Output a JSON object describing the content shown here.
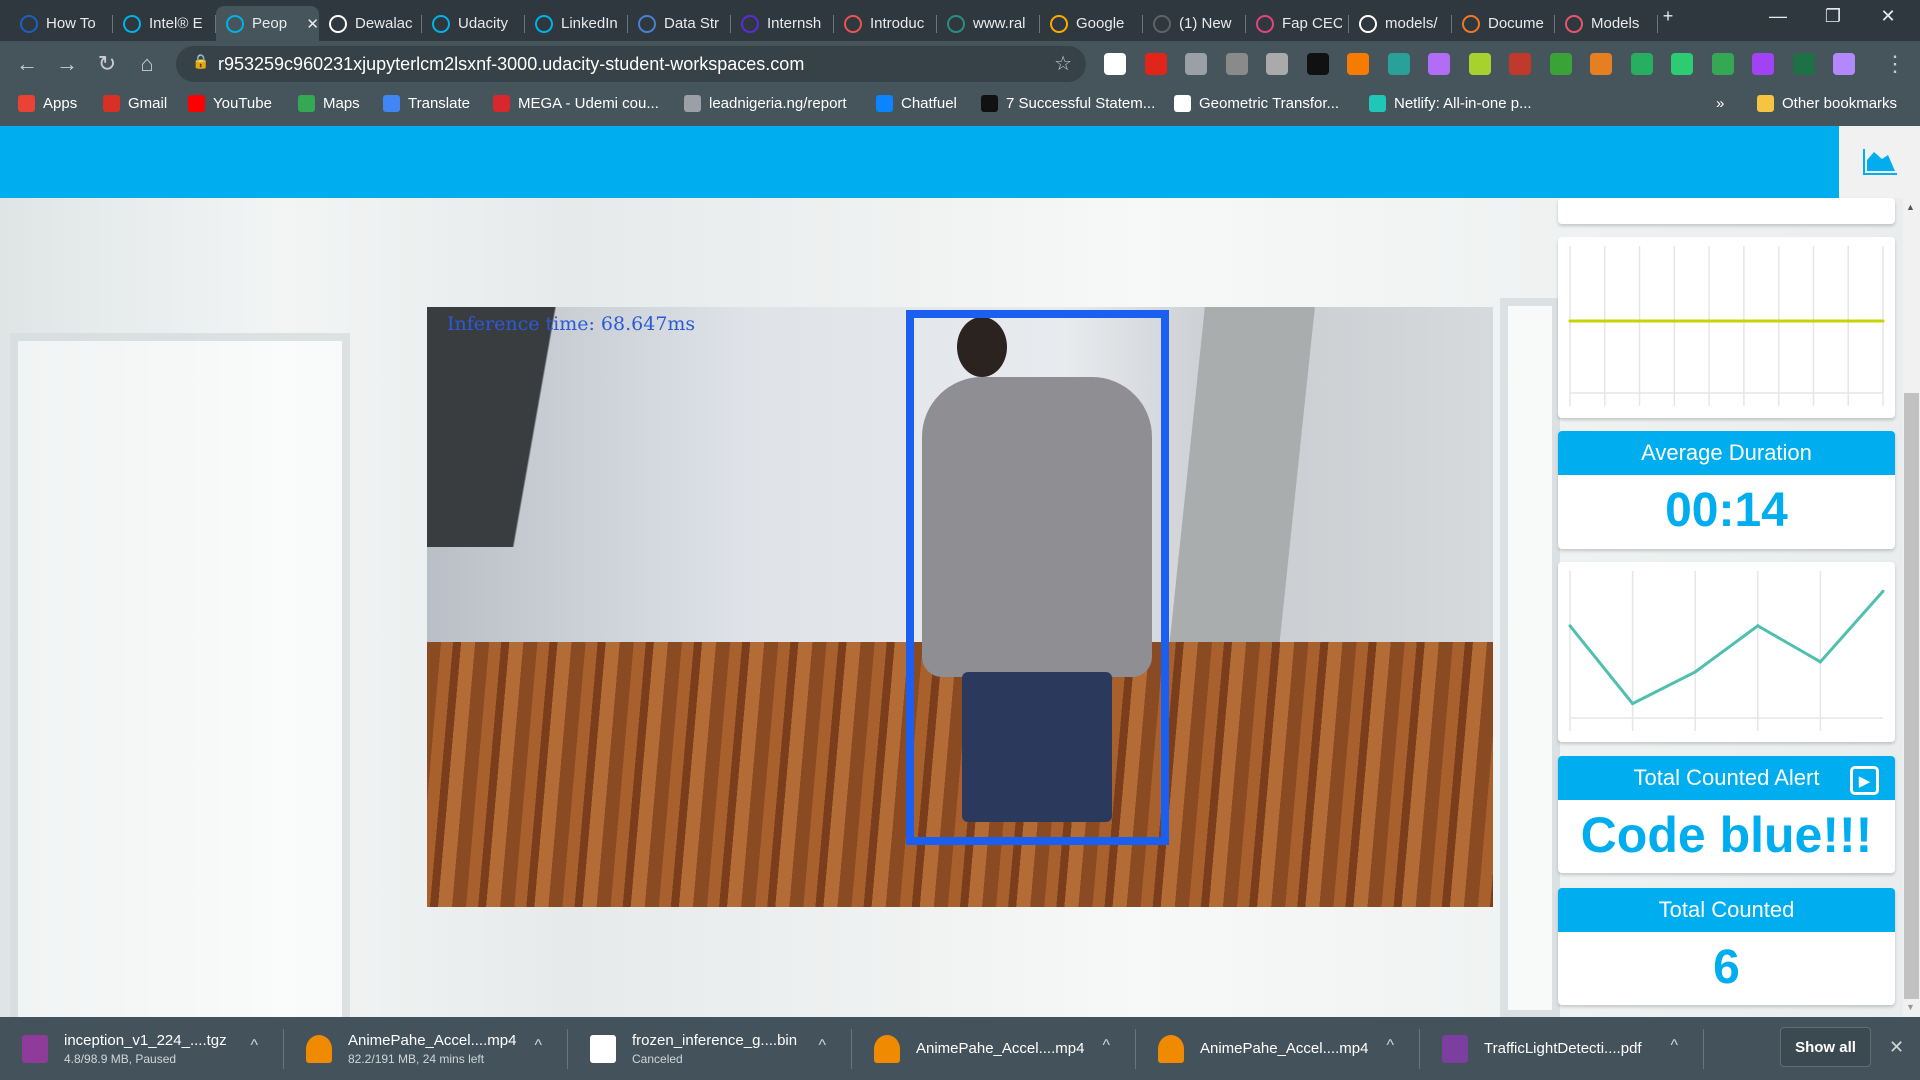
{
  "browser": {
    "tabs": [
      {
        "label": "How To",
        "icon": "edge-e-icon",
        "color": "#1e5fbf"
      },
      {
        "label": "Intel® E",
        "icon": "udacity-icon",
        "color": "#02b3e4"
      },
      {
        "label": "Peop",
        "icon": "udacity-icon",
        "color": "#02b3e4",
        "active": true
      },
      {
        "label": "Dewalac",
        "icon": "github-icon",
        "color": "#ffffff"
      },
      {
        "label": "Udacity",
        "icon": "udacity-icon",
        "color": "#02b3e4"
      },
      {
        "label": "LinkedIn",
        "icon": "udacity-icon",
        "color": "#02b3e4"
      },
      {
        "label": "Data Str",
        "icon": "infinity-icon",
        "color": "#4a7fd1"
      },
      {
        "label": "Internsh",
        "icon": "hash-icon",
        "color": "#5b2bd8"
      },
      {
        "label": "Introduc",
        "icon": "udemy-icon",
        "color": "#ec5252"
      },
      {
        "label": "www.ral",
        "icon": "t-icon",
        "color": "#2e8b7f"
      },
      {
        "label": "Google",
        "icon": "analytics-icon",
        "color": "#f9ab00"
      },
      {
        "label": "(1) New",
        "icon": "globe-icon",
        "color": "#5f6368"
      },
      {
        "label": "Fap CEC",
        "icon": "fap-icon",
        "color": "#e0457b"
      },
      {
        "label": "models/",
        "icon": "github-icon",
        "color": "#ffffff"
      },
      {
        "label": "Docume",
        "icon": "jupyter-icon",
        "color": "#f37726"
      },
      {
        "label": "Models",
        "icon": "tree-icon",
        "color": "#e8566c"
      }
    ],
    "new_tab": "+",
    "url": "r953259c960231xjupyterlcm2lsxnf-3000.udacity-student-workspaces.com",
    "bookmarks": [
      {
        "label": "Apps",
        "color": "#ea4335"
      },
      {
        "label": "Gmail",
        "color": "#d93025"
      },
      {
        "label": "YouTube",
        "color": "#ff0000"
      },
      {
        "label": "Maps",
        "color": "#34a853"
      },
      {
        "label": "Translate",
        "color": "#4285f4"
      },
      {
        "label": "MEGA - Udemi cou...",
        "color": "#d9272e"
      },
      {
        "label": "leadnigeria.ng/report",
        "color": "#9aa0a6"
      },
      {
        "label": "Chatfuel",
        "color": "#0a84ff"
      },
      {
        "label": "7 Successful Statem...",
        "color": "#111111"
      },
      {
        "label": "Geometric Transfor...",
        "color": "#ffffff"
      },
      {
        "label": "Netlify: All-in-one p...",
        "color": "#20c6b7"
      }
    ],
    "overflow": "»",
    "other_bookmarks": "Other bookmarks"
  },
  "app": {
    "accent": "#00aeef",
    "video": {
      "overlay_text": "Inference time: 68.647ms",
      "box_color": "#1a5ff0"
    },
    "cards": {
      "average_duration": {
        "title": "Average Duration",
        "value": "00:14"
      },
      "alert": {
        "title": "Total Counted Alert",
        "value": "Code blue!!!"
      },
      "total": {
        "title": "Total Counted",
        "value": "6"
      }
    }
  },
  "chart_data": [
    {
      "type": "line",
      "values": [
        50,
        50,
        50,
        50,
        50,
        50,
        50,
        50,
        50,
        50
      ],
      "ylim": [
        0,
        100
      ],
      "grid": true,
      "color": "#c8d400"
    },
    {
      "type": "line",
      "values": [
        64,
        10,
        32,
        64,
        39,
        88
      ],
      "ylim": [
        0,
        100
      ],
      "grid": true,
      "color": "#4fbfb0"
    }
  ],
  "downloads": {
    "items": [
      {
        "name": "inception_v1_224_....tgz",
        "status": "4.8/98.9 MB, Paused",
        "icon": "winrar-icon"
      },
      {
        "name": "AnimePahe_Accel....mp4",
        "status": "82.2/191 MB, 24 mins left",
        "icon": "vlc-icon"
      },
      {
        "name": "frozen_inference_g....bin",
        "status": "Canceled",
        "icon": "file-icon"
      },
      {
        "name": "AnimePahe_Accel....mp4",
        "status": "",
        "icon": "vlc-icon"
      },
      {
        "name": "AnimePahe_Accel....mp4",
        "status": "",
        "icon": "vlc-icon"
      },
      {
        "name": "TrafficLightDetecti....pdf",
        "status": "",
        "icon": "pdf-icon"
      }
    ],
    "show_all": "Show all",
    "close": "✕"
  }
}
